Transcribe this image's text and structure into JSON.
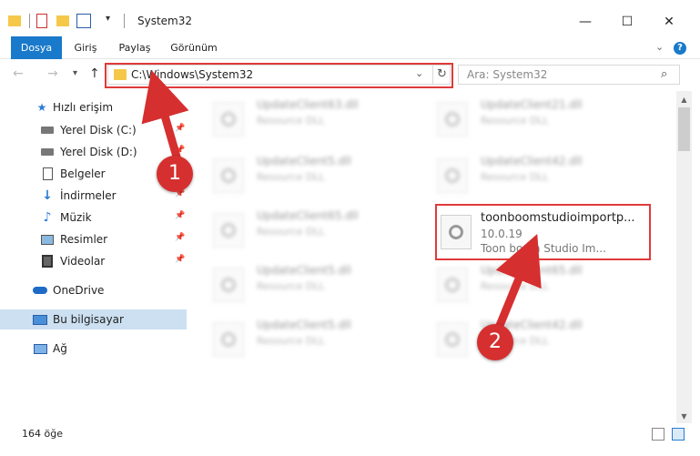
{
  "window": {
    "title": "System32",
    "controls": {
      "minimize": "—",
      "maximize": "☐",
      "close": "✕"
    }
  },
  "ribbon": {
    "tabs": [
      {
        "label": "Dosya",
        "active": true
      },
      {
        "label": "Giriş",
        "active": false
      },
      {
        "label": "Paylaş",
        "active": false
      },
      {
        "label": "Görünüm",
        "active": false
      }
    ],
    "help": "?"
  },
  "nav": {
    "back": "←",
    "forward": "→",
    "recent": "▾",
    "up": "↑",
    "address": "C:\\Windows\\System32",
    "search_placeholder": "Ara: System32"
  },
  "sidebar": {
    "items": [
      {
        "label": "Hızlı erişim",
        "icon": "star-icon",
        "pinned": false
      },
      {
        "label": "Yerel Disk (C:)",
        "icon": "drive-icon",
        "pinned": true
      },
      {
        "label": "Yerel Disk (D:)",
        "icon": "drive-icon",
        "pinned": true
      },
      {
        "label": "Belgeler",
        "icon": "document-icon",
        "pinned": true
      },
      {
        "label": "İndirmeler",
        "icon": "download-icon",
        "pinned": true
      },
      {
        "label": "Müzik",
        "icon": "music-icon",
        "pinned": true
      },
      {
        "label": "Resimler",
        "icon": "picture-icon",
        "pinned": true
      },
      {
        "label": "Videolar",
        "icon": "video-icon",
        "pinned": true
      },
      {
        "label": "OneDrive",
        "icon": "cloud-icon",
        "pinned": false
      },
      {
        "label": "Bu bilgisayar",
        "icon": "computer-icon",
        "pinned": false,
        "selected": true
      },
      {
        "label": "Ağ",
        "icon": "network-icon",
        "pinned": false
      }
    ]
  },
  "files": {
    "left_column": [
      {
        "name": "UpdateClient63.dll",
        "desc": "Resource DLL"
      },
      {
        "name": "UpdateClient5.dll",
        "desc": "Resource DLL"
      },
      {
        "name": "UpdateClient65.dll",
        "desc": "Resource DLL"
      },
      {
        "name": "UpdateClient5.dll",
        "desc": "Resource DLL"
      },
      {
        "name": "UpdateClient5.dll",
        "desc": "Resource DLL"
      }
    ],
    "right_column": [
      {
        "name": "UpdateClient21.dll",
        "desc": "Resource DLL"
      },
      {
        "name": "UpdateClient42.dll",
        "desc": "Resource DLL"
      },
      {
        "name": "UpdateClient65.dll",
        "desc": "Resource DLL"
      },
      {
        "name": "UpdateClient42.dll",
        "desc": "Resource DLL"
      }
    ],
    "highlighted": {
      "name": "toonboomstudioimportp...",
      "version": "10.0.19",
      "desc": "Toon boom Studio Im..."
    }
  },
  "status": {
    "count": "164 öğe"
  },
  "annotations": {
    "badge1": "1",
    "badge2": "2",
    "color": "#d62f2f"
  }
}
